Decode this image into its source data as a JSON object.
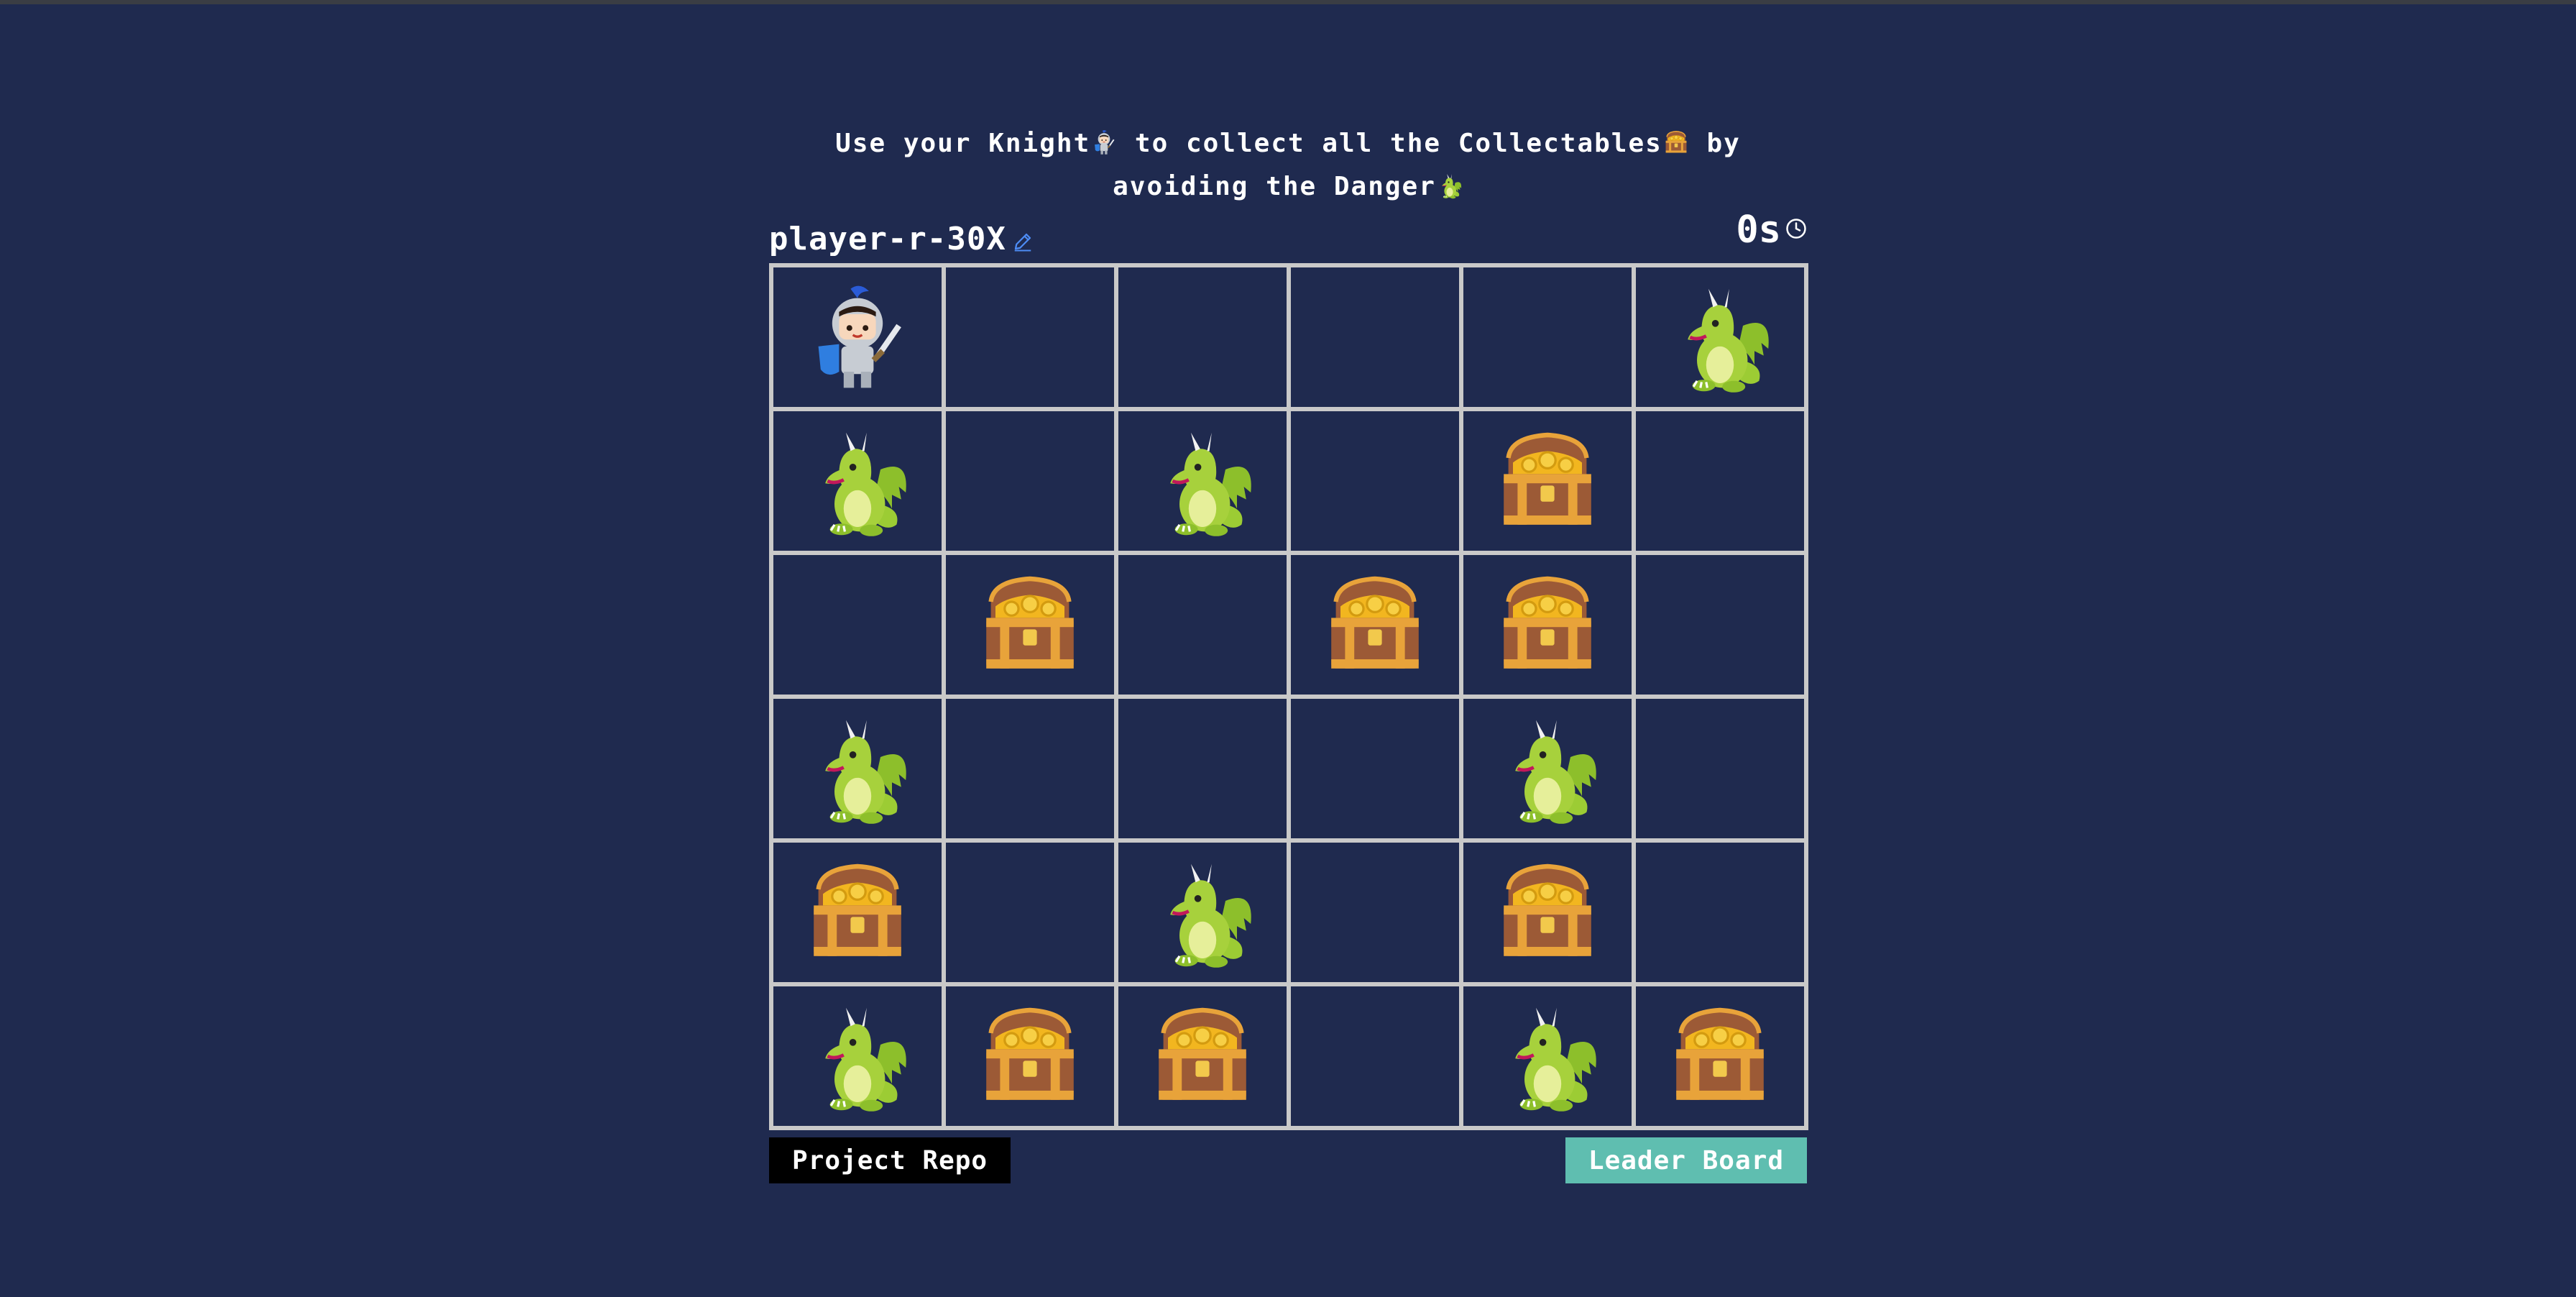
{
  "instructions": {
    "part1": "Use your Knight",
    "part2": " to collect all the Collectables",
    "part3": " by avoiding the Danger"
  },
  "player": {
    "name": "player-r-30X"
  },
  "timer": {
    "value": "0s"
  },
  "board": {
    "rows": 6,
    "cols": 6,
    "cells": [
      [
        "knight",
        "empty",
        "empty",
        "empty",
        "empty",
        "dragon"
      ],
      [
        "dragon",
        "empty",
        "dragon",
        "empty",
        "chest",
        "empty"
      ],
      [
        "empty",
        "chest",
        "empty",
        "chest",
        "chest",
        "empty"
      ],
      [
        "dragon",
        "empty",
        "empty",
        "empty",
        "dragon",
        "empty"
      ],
      [
        "chest",
        "empty",
        "dragon",
        "empty",
        "chest",
        "empty"
      ],
      [
        "dragon",
        "chest",
        "chest",
        "empty",
        "dragon",
        "chest"
      ]
    ]
  },
  "buttons": {
    "repo": "Project Repo",
    "leaderboard": "Leader Board"
  },
  "colors": {
    "background": "#1f2a4f",
    "grid": "#c9c9c9",
    "leaderboard_button": "#5fbeb0",
    "edit_icon": "#4d8cf5"
  },
  "icons": {
    "knight": "knight-icon",
    "dragon": "dragon-icon",
    "chest": "treasure-chest-icon",
    "edit": "pencil-icon",
    "clock": "clock-icon"
  }
}
